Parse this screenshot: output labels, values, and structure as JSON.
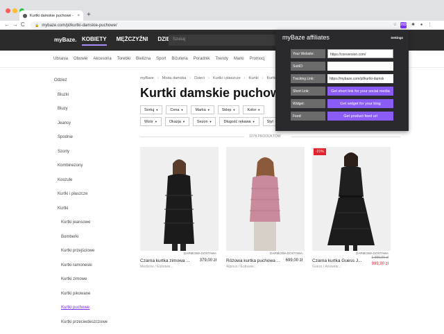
{
  "browser": {
    "tab_title": "Kurtki damskie puchowe - Koi",
    "tab_close": "×",
    "new_tab": "+",
    "back": "←",
    "forward": "→",
    "reload": "C",
    "lock": "🔒",
    "url": "mybaze.com/pl/kurtki-damskie-puchowe/",
    "ext_initials": "mb"
  },
  "site": {
    "logo": "myBaze.",
    "nav": [
      "KOBIETY",
      "MĘŻCZYŹNI",
      "DZIECI"
    ],
    "search_placeholder": "Szukaj",
    "subnav": [
      "Ubrania",
      "Obuwie",
      "Akcesoria",
      "Torebki",
      "Bielizna",
      "Sport",
      "Biżuteria",
      "Poradnik",
      "Trendy",
      "Marki",
      "Promocj"
    ]
  },
  "sidebar": {
    "items": [
      {
        "label": "Odzież",
        "level": 1
      },
      {
        "label": "Bluzki",
        "level": 2
      },
      {
        "label": "Bluzy",
        "level": 2
      },
      {
        "label": "Jeansy",
        "level": 2
      },
      {
        "label": "Spodnie",
        "level": 2
      },
      {
        "label": "Szorty",
        "level": 2
      },
      {
        "label": "Kombinezony",
        "level": 2
      },
      {
        "label": "Koszule",
        "level": 2
      },
      {
        "label": "Kurtki i płaszcze",
        "level": 2
      },
      {
        "label": "Kurtki",
        "level": 2
      },
      {
        "label": "Kurtki jeansowe",
        "level": 3
      },
      {
        "label": "Bomberki",
        "level": 3
      },
      {
        "label": "Kurtki przejściowe",
        "level": 3
      },
      {
        "label": "Kurtki ramoneski",
        "level": 3
      },
      {
        "label": "Kurtki zimowe",
        "level": 3
      },
      {
        "label": "Kurtki pikowane",
        "level": 3
      },
      {
        "label": "Kurtki puchowe",
        "level": 3,
        "active": true
      },
      {
        "label": "Kurtki przeciwdeszczowe",
        "level": 3
      }
    ]
  },
  "content": {
    "breadcrumb": [
      "myBaze",
      "Moda damska",
      "Dzieci",
      "Kurtki i płaszcze",
      "Kurtki",
      "Kurtki damskie"
    ],
    "breadcrumb_sep": "›",
    "title": "Kurtki damskie puchowe",
    "filters": [
      "Sortuj",
      "Cena",
      "Marka",
      "Sklep",
      "Kolor",
      "Wzór",
      "Okazja",
      "Sezon",
      "Długość rękawa",
      "Styl"
    ],
    "product_count": "1278 PRODUKTÓW",
    "products": [
      {
        "name": "Czarna kurtka zimowa ...",
        "price": "379,00 zł",
        "brand": "Medicine / Eobuwie...",
        "shipping": "DARMOWA DOSTAWA"
      },
      {
        "name": "Różowa kurtka puchowa ...",
        "price": "699,00 zł",
        "brand": "Alpinus / Eobuwie...",
        "shipping": "DARMOWA DOSTAWA"
      },
      {
        "name": "Czarna kurtka Guess J...",
        "old_price": "1 399,90 zł",
        "new_price": "999,90 zł",
        "badge": "-21%",
        "brand": "Guess / Answear...",
        "shipping": "DARMOWA DOSTAWA"
      }
    ]
  },
  "affiliate": {
    "title": "myBaze affiliates",
    "settings": "Settings",
    "rows": [
      {
        "label": "Your Website:",
        "value": "https://conversion.com/",
        "type": "select"
      },
      {
        "label": "SubID:",
        "value": "",
        "type": "input"
      },
      {
        "label": "Tracking Link:",
        "value": "https://mybaze.com/pl/kurtki-damsk",
        "type": "input"
      },
      {
        "label": "Short Link:",
        "value": "Get short link for your social media",
        "type": "button"
      },
      {
        "label": "Widget:",
        "value": "Get widget for your blog",
        "type": "button"
      },
      {
        "label": "Feed:",
        "value": "Get product feed url",
        "type": "button"
      }
    ]
  },
  "colors": {
    "accent": "#7b2ff7",
    "button": "#8a5cf5",
    "sale": "#e0232e",
    "header": "#2b2b2b",
    "popup": "#2a2a2e"
  }
}
